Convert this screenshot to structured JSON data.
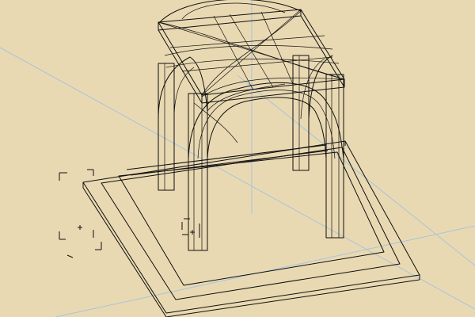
{
  "viewport": {
    "background": "#e9d9b2",
    "wire_color": "#101010",
    "axis_color": "#a8c4dc",
    "view_mode": "wireframe"
  },
  "model": {
    "object": "domed-pavilion",
    "parts": [
      "stepped-base",
      "corner-piers",
      "arches",
      "cross-vaulted-canopy",
      "roof-slab"
    ]
  },
  "markers": {
    "icon": "crosshair-icon",
    "count": 2
  }
}
